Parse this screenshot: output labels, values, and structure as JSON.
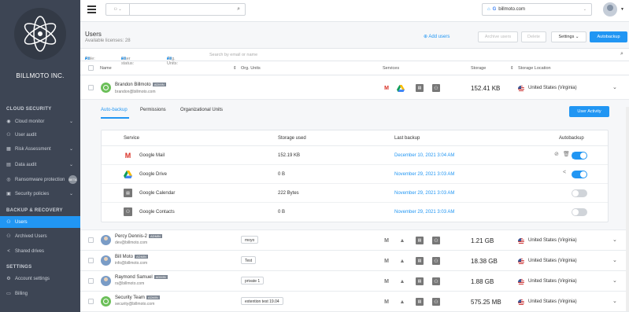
{
  "company": "BILLMOTO INC.",
  "sidebar": {
    "sections": [
      {
        "title": "CLOUD SECURITY"
      },
      {
        "title": "BACKUP & RECOVERY"
      },
      {
        "title": "SETTINGS"
      }
    ],
    "items": [
      {
        "label": "Cloud monitor",
        "icon": "gauge-icon"
      },
      {
        "label": "User audit",
        "icon": "user-icon"
      },
      {
        "label": "Risk Assessment",
        "icon": "grid-icon"
      },
      {
        "label": "Data audit",
        "icon": "file-icon"
      },
      {
        "label": "Ransomware protection",
        "icon": "shield-icon",
        "badge": "BETA"
      },
      {
        "label": "Security policies",
        "icon": "doc-icon"
      },
      {
        "label": "Users",
        "icon": "users-icon"
      },
      {
        "label": "Archived Users",
        "icon": "archive-icon"
      },
      {
        "label": "Shared drives",
        "icon": "share-icon"
      },
      {
        "label": "Account settings",
        "icon": "gear-icon"
      },
      {
        "label": "Billing",
        "icon": "card-icon"
      }
    ]
  },
  "topbar": {
    "url": "billmoto.com"
  },
  "header": {
    "title": "Users",
    "licenses": "Available licenses: 28",
    "add_users": "Add users",
    "archive_users": "Archive users",
    "delete": "Delete",
    "settings": "Settings",
    "autobackup": "Autobackup"
  },
  "filters": {
    "role_label": "Role:",
    "role_value": "All",
    "status_label": "User status:",
    "status_value": "All",
    "org_label": "Org. Units:",
    "org_value": "All",
    "search_placeholder": "Search by email or name"
  },
  "columns": {
    "name": "Name",
    "org_units": "Org. Units",
    "services": "Services",
    "storage": "Storage",
    "location": "Storage Location"
  },
  "users": [
    {
      "name": "Brandon Billmoto",
      "email": "brandon@billmoto.com",
      "admin": "ADMIN",
      "org_unit": "",
      "storage": "152.41 KB",
      "location": "United States (Virginia)"
    },
    {
      "name": "Percy Dennis-2",
      "email": "dev@billmoto.com",
      "admin": "ADMIN",
      "org_unit": "moyo",
      "storage": "1.21 GB",
      "location": "United States (Virginia)"
    },
    {
      "name": "Bill Moto",
      "email": "info@billmoto.com",
      "admin": "ADMIN",
      "org_unit": "Test",
      "storage": "18.38 GB",
      "location": "United States (Virginia)"
    },
    {
      "name": "Raymond Samuel",
      "email": "rs@billmoto.com",
      "admin": "ADMIN",
      "org_unit": "private 1",
      "storage": "1.88 GB",
      "location": "United States (Virginia)"
    },
    {
      "name": "Security Team",
      "email": "security@billmoto.com",
      "admin": "ADMIN",
      "org_unit": "extention test 19.04",
      "storage": "575.25 MB",
      "location": "United States (Virginia)"
    }
  ],
  "detail": {
    "tabs": [
      "Auto-backup",
      "Permissions",
      "Organizational Units"
    ],
    "user_activity": "User Activity",
    "headers": {
      "service": "Service",
      "storage_used": "Storage used",
      "last_backup": "Last backup",
      "autobackup": "Autobackup"
    },
    "services": [
      {
        "name": "Google Mail",
        "storage": "152.19 KB",
        "last_backup": "December 10, 2021 3:04 AM",
        "enabled": true
      },
      {
        "name": "Google Drive",
        "storage": "0 B",
        "last_backup": "November 29, 2021 3:03 AM",
        "enabled": true
      },
      {
        "name": "Google Calendar",
        "storage": "222 Bytes",
        "last_backup": "November 29, 2021 3:03 AM",
        "enabled": false
      },
      {
        "name": "Google Contacts",
        "storage": "0 B",
        "last_backup": "November 29, 2021 3:03 AM",
        "enabled": false
      }
    ]
  },
  "colors": {
    "accent": "#2196f3",
    "sidebar": "#3d4554",
    "admin_badge": "#7c8591"
  }
}
